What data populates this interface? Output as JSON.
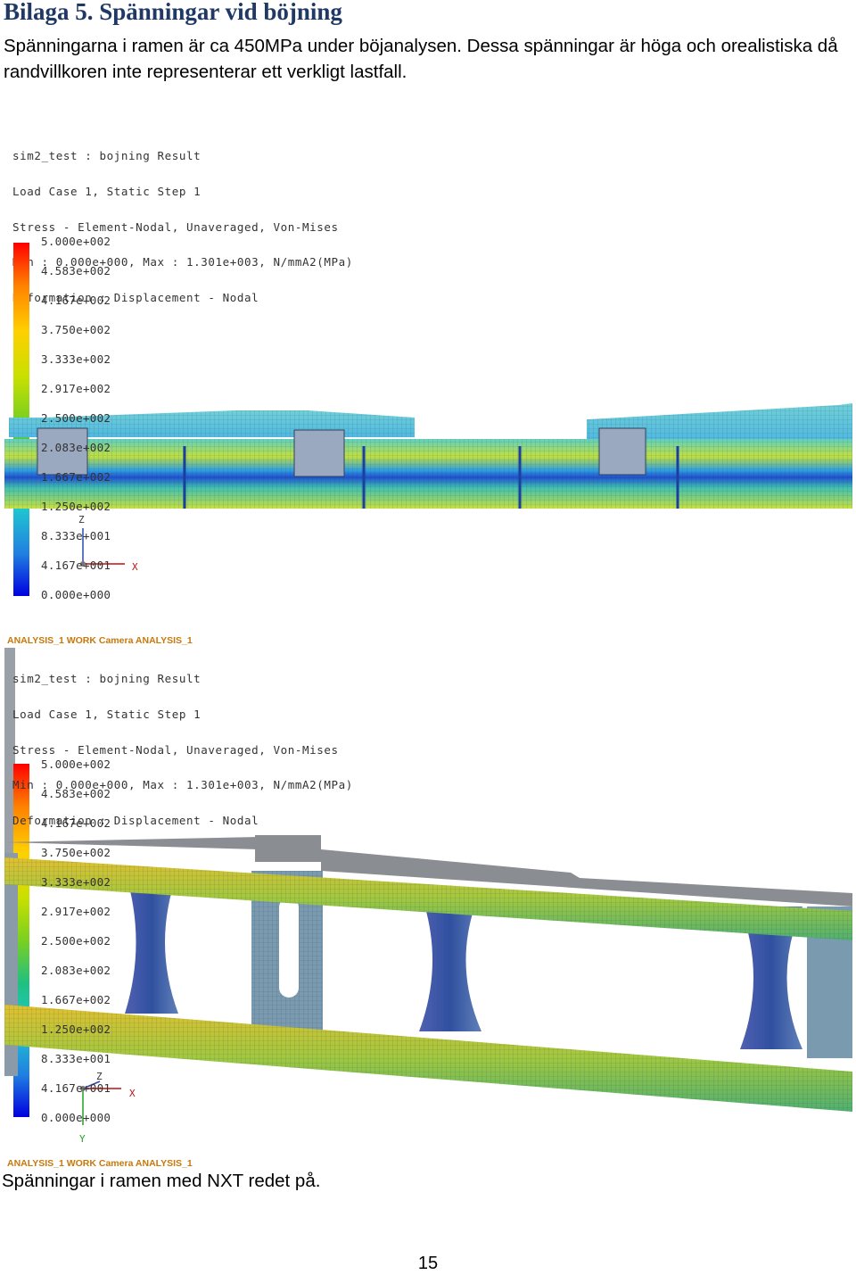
{
  "heading": "Bilaga 5. Spänningar vid böjning",
  "paragraph": "Spänningarna i ramen är ca 450MPa under böjanalysen. Dessa spänningar är höga och orealistiska då randvillkoren inte representerar ett verkligt lastfall.",
  "figures": [
    {
      "result_lines": [
        "sim2_test : bojning Result",
        "Load Case 1, Static Step 1",
        "Stress - Element-Nodal, Unaveraged, Von-Mises",
        "Min : 0.000e+000, Max : 1.301e+003, N/mmA2(MPa)",
        "Deformation : Displacement - Nodal"
      ],
      "legend_values": [
        "5.000e+002",
        "4.583e+002",
        "4.167e+002",
        "3.750e+002",
        "3.333e+002",
        "2.917e+002",
        "2.500e+002",
        "2.083e+002",
        "1.667e+002",
        "1.250e+002",
        "8.333e+001",
        "4.167e+001",
        "0.000e+000"
      ],
      "axes": {
        "z": "Z",
        "x": "X"
      },
      "camera_label": ""
    },
    {
      "top_camera_label": "ANALYSIS_1 WORK Camera ANALYSIS_1",
      "result_lines": [
        "sim2_test : bojning Result",
        "Load Case 1, Static Step 1",
        "Stress - Element-Nodal, Unaveraged, Von-Mises",
        "Min : 0.000e+000, Max : 1.301e+003, N/mmA2(MPa)",
        "Deformation : Displacement - Nodal"
      ],
      "legend_values": [
        "5.000e+002",
        "4.583e+002",
        "4.167e+002",
        "3.750e+002",
        "3.333e+002",
        "2.917e+002",
        "2.500e+002",
        "2.083e+002",
        "1.667e+002",
        "1.250e+002",
        "8.333e+001",
        "4.167e+001",
        "0.000e+000"
      ],
      "axes": {
        "z": "Z",
        "x": "X",
        "y": "Y"
      },
      "camera_label": "ANALYSIS_1 WORK Camera ANALYSIS_1"
    }
  ],
  "caption": "Spänningar i ramen med NXT redet på.",
  "page_number": "15",
  "colors": {
    "heading": "#1f3864",
    "camera_label": "#c8780a",
    "colormap": [
      "#ff0000",
      "#ff8000",
      "#ffd000",
      "#c8e000",
      "#7ad020",
      "#20c080",
      "#20c8d0",
      "#2080e0",
      "#0000e0"
    ]
  }
}
